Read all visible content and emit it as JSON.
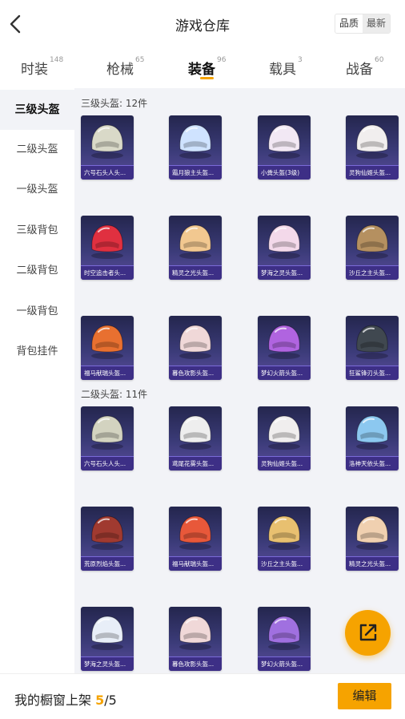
{
  "header": {
    "title": "游戏仓库",
    "sort_quality": "品质",
    "sort_newest": "最新"
  },
  "tabs": [
    {
      "label": "时装",
      "count": "148"
    },
    {
      "label": "枪械",
      "count": "65"
    },
    {
      "label": "装备",
      "count": "96",
      "active": true
    },
    {
      "label": "载具",
      "count": "3"
    },
    {
      "label": "战备",
      "count": "60"
    }
  ],
  "sidebar": {
    "items": [
      "三级头盔",
      "二级头盔",
      "一级头盔",
      "三级背包",
      "二级背包",
      "一级背包",
      "背包挂件"
    ],
    "active_index": 0
  },
  "sections": [
    {
      "title": "三级头盔: 12件",
      "items": [
        {
          "name": "六号石头人头...",
          "color": "#d9d9c8"
        },
        {
          "name": "霜月狼主头盔...",
          "color": "#cfe3ff"
        },
        {
          "name": "小粪头盔(3级)",
          "color": "#f2e8f4"
        },
        {
          "name": "灵狗仙姬头盔...",
          "color": "#f1eeee"
        },
        {
          "name": "时空追击者头...",
          "color": "#e03040"
        },
        {
          "name": "精灵之光头盔...",
          "color": "#f2c890"
        },
        {
          "name": "梦海之灵头盔...",
          "color": "#f3d9ea"
        },
        {
          "name": "沙丘之主头盔...",
          "color": "#b59060"
        },
        {
          "name": "福马献瑞头盔...",
          "color": "#e87030"
        },
        {
          "name": "暮色攻影头盔...",
          "color": "#f0d8d8"
        },
        {
          "name": "梦幻火箭头盔...",
          "color": "#b064e0"
        },
        {
          "name": "狂鲨锋刃头盔...",
          "color": "#404850"
        }
      ]
    },
    {
      "title": "二级头盔: 11件",
      "items": [
        {
          "name": "六号石头人头...",
          "color": "#d3d3c0"
        },
        {
          "name": "鸢尾花雾头盔...",
          "color": "#eeeeee"
        },
        {
          "name": "灵狗仙姬头盔...",
          "color": "#f0eeee"
        },
        {
          "name": "洛神天依头盔...",
          "color": "#8cc8f0"
        },
        {
          "name": "荒原烈焰头盔...",
          "color": "#a03a30"
        },
        {
          "name": "福马献瑞头盔...",
          "color": "#e8583a"
        },
        {
          "name": "沙丘之主头盔...",
          "color": "#e8c070"
        },
        {
          "name": "精灵之光头盔...",
          "color": "#f0d0b0"
        },
        {
          "name": "梦海之灵头盔...",
          "color": "#e8eef8"
        },
        {
          "name": "暮色攻影头盔...",
          "color": "#f0d8d8"
        },
        {
          "name": "梦幻火箭头盔...",
          "color": "#a070e0"
        }
      ]
    }
  ],
  "bottom_bar": {
    "label": "我的橱窗上架",
    "count_current": "5",
    "count_separator": "/",
    "count_total": "5",
    "edit_label": "编辑"
  },
  "icons": {
    "back": "back-arrow-icon",
    "fab": "share-icon"
  },
  "accent_color": "#f6a300"
}
